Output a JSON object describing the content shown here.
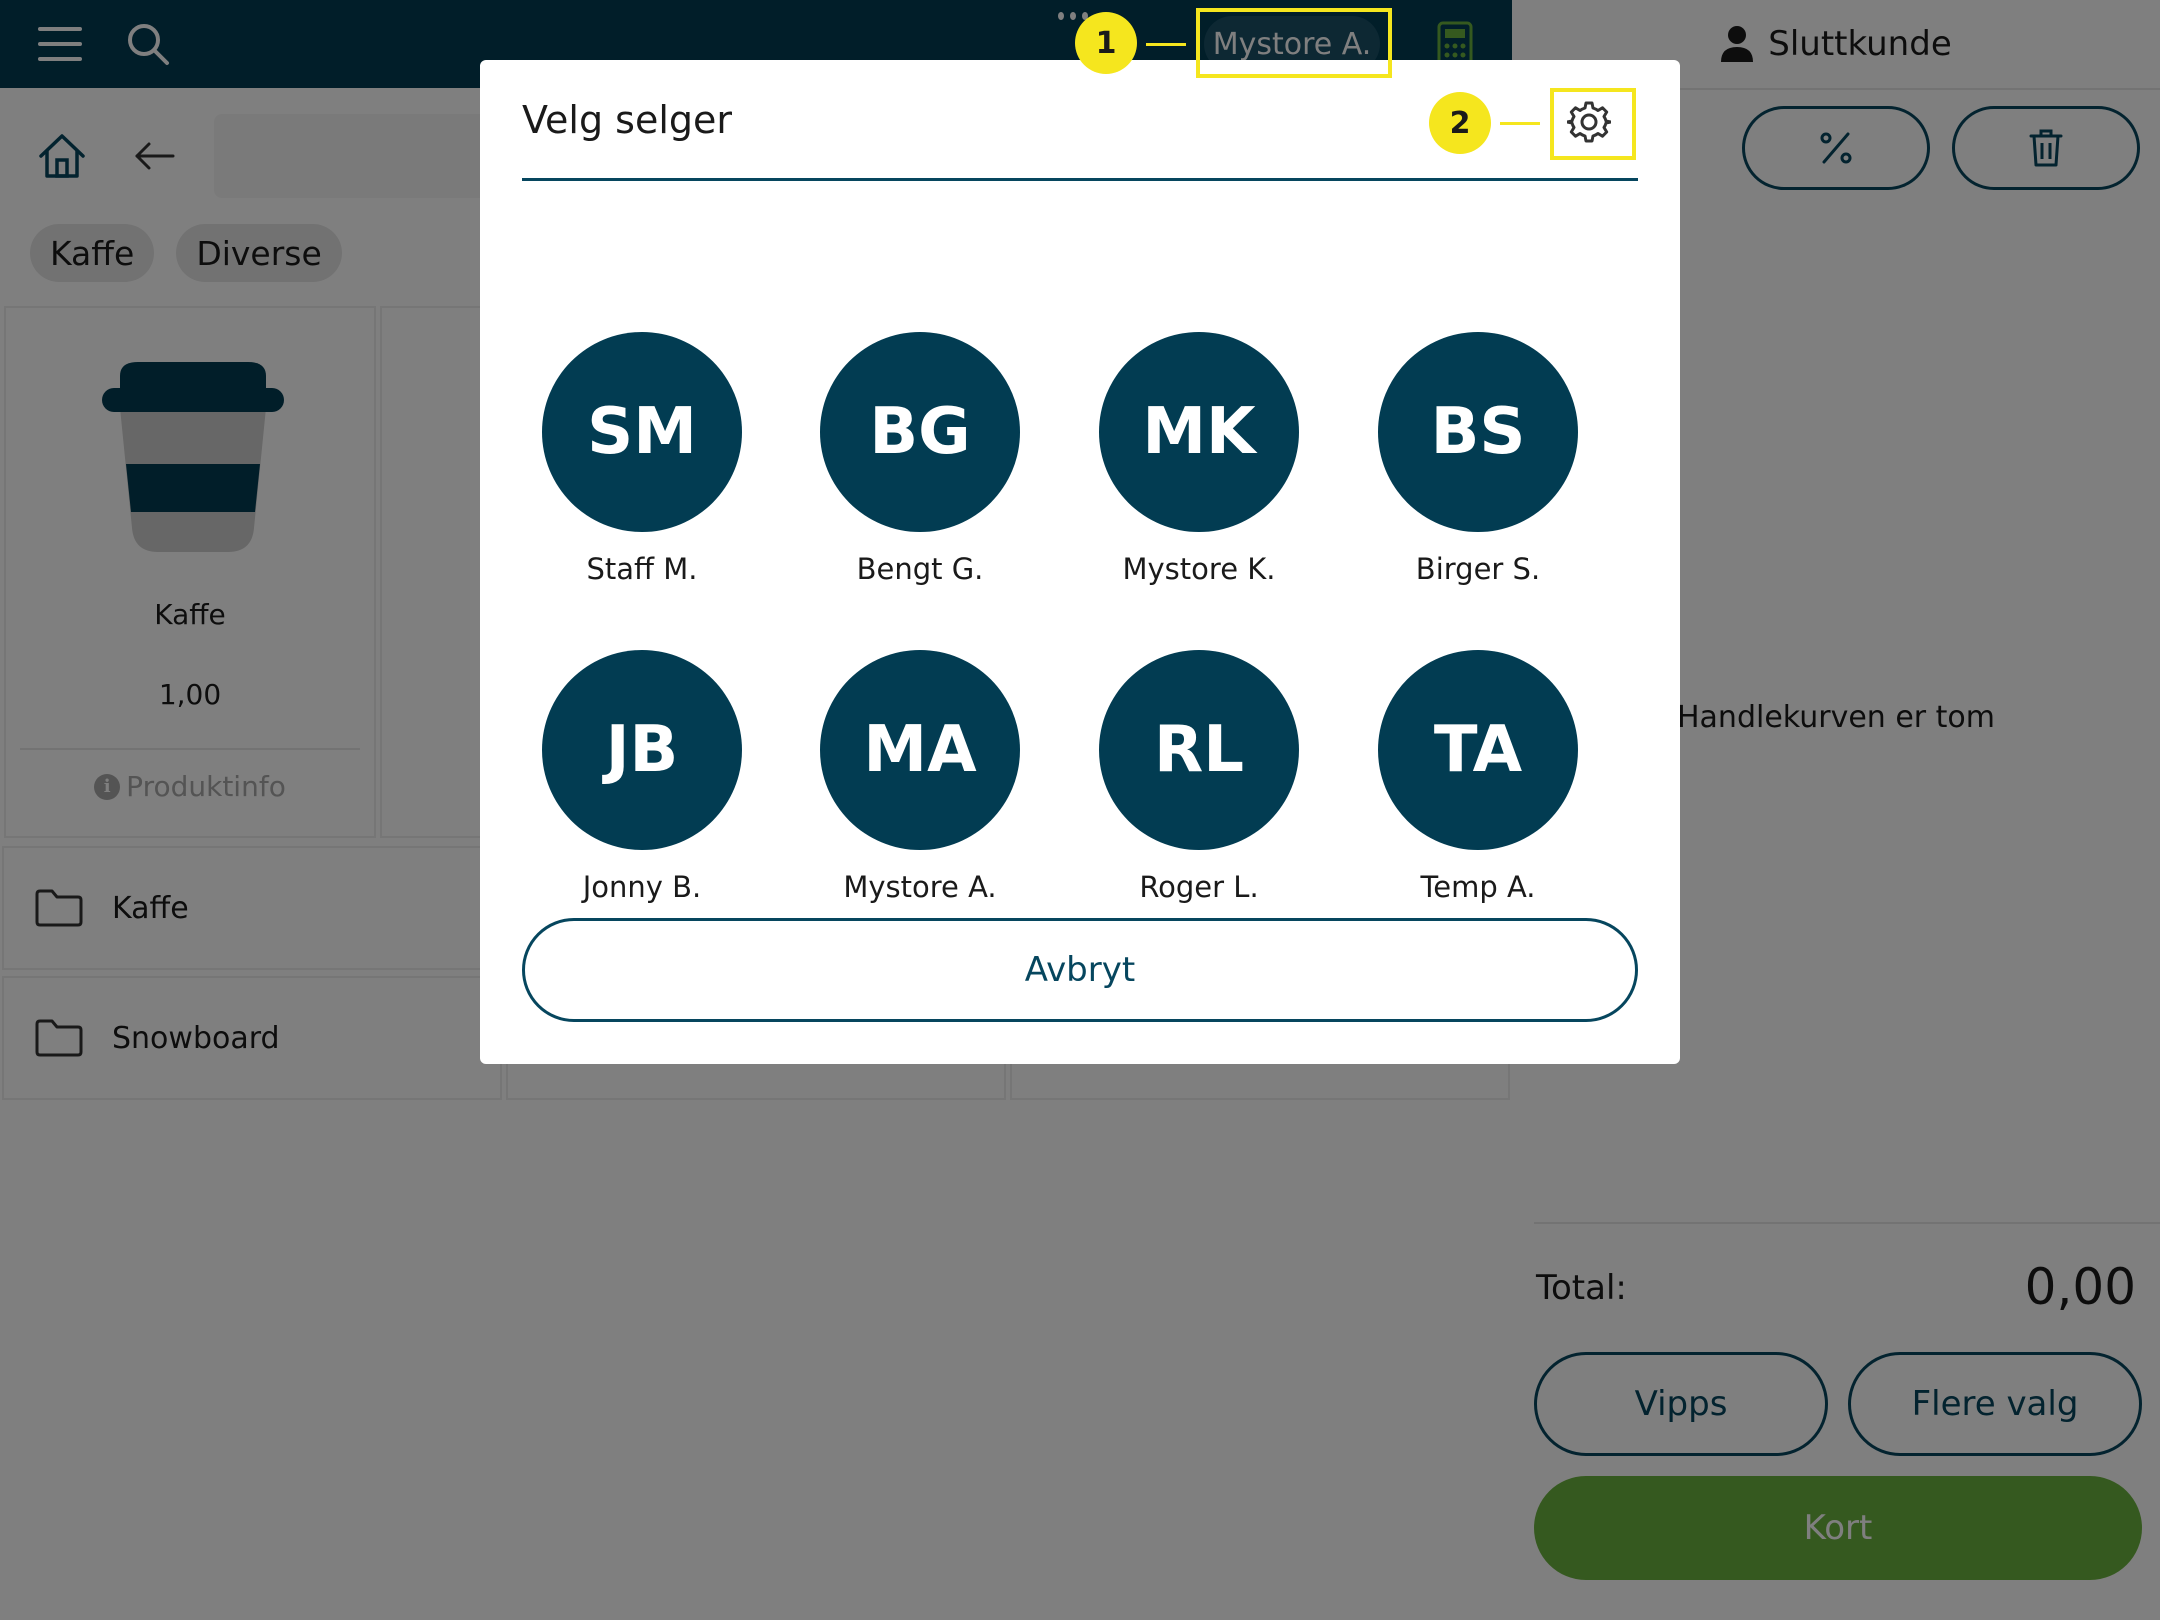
{
  "topbar": {
    "current_user": "Mystore A."
  },
  "categories": [
    "Kaffe",
    "Diverse"
  ],
  "products": [
    {
      "name": "Kaffe",
      "price": "1,00",
      "info_label": "Produktinfo"
    }
  ],
  "folders": [
    {
      "label": "Kaffe"
    },
    {
      "label": "Snowboard"
    }
  ],
  "cart": {
    "customer_label": "Sluttkunde",
    "empty_text": "Handlekurven er tom",
    "total_label": "Total:",
    "total_value": "0,00",
    "pay_buttons": [
      "Vipps",
      "Flere valg"
    ],
    "card_label": "Kort"
  },
  "modal": {
    "title": "Velg selger",
    "sellers": [
      {
        "initials": "SM",
        "name": "Staff M."
      },
      {
        "initials": "BG",
        "name": "Bengt G."
      },
      {
        "initials": "MK",
        "name": "Mystore K."
      },
      {
        "initials": "BS",
        "name": "Birger S."
      },
      {
        "initials": "JB",
        "name": "Jonny B."
      },
      {
        "initials": "MA",
        "name": "Mystore A."
      },
      {
        "initials": "RL",
        "name": "Roger L."
      },
      {
        "initials": "TA",
        "name": "Temp A."
      }
    ],
    "cancel_label": "Avbryt"
  },
  "callouts": [
    {
      "number": "1"
    },
    {
      "number": "2"
    }
  ],
  "colors": {
    "primary": "#023c52",
    "accent_green": "#6ab23e",
    "callout_yellow": "#f5e61e"
  }
}
